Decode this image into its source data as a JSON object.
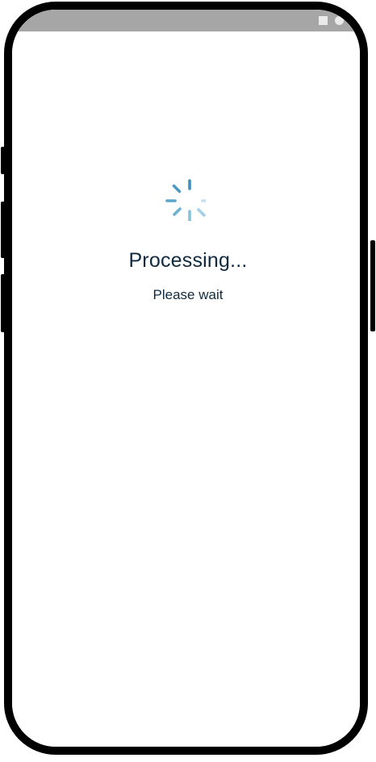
{
  "status_bar": {
    "icons": [
      "square-icon",
      "circle-icon"
    ]
  },
  "loading": {
    "spinner_icon": "spinner-icon",
    "title": "Processing...",
    "subtitle": "Please wait"
  },
  "colors": {
    "text": "#0f2a40",
    "spinner_dark": "#4a9ac2",
    "spinner_light": "#cfe6f2",
    "status_bar": "#a6a6a6",
    "frame": "#000000"
  }
}
